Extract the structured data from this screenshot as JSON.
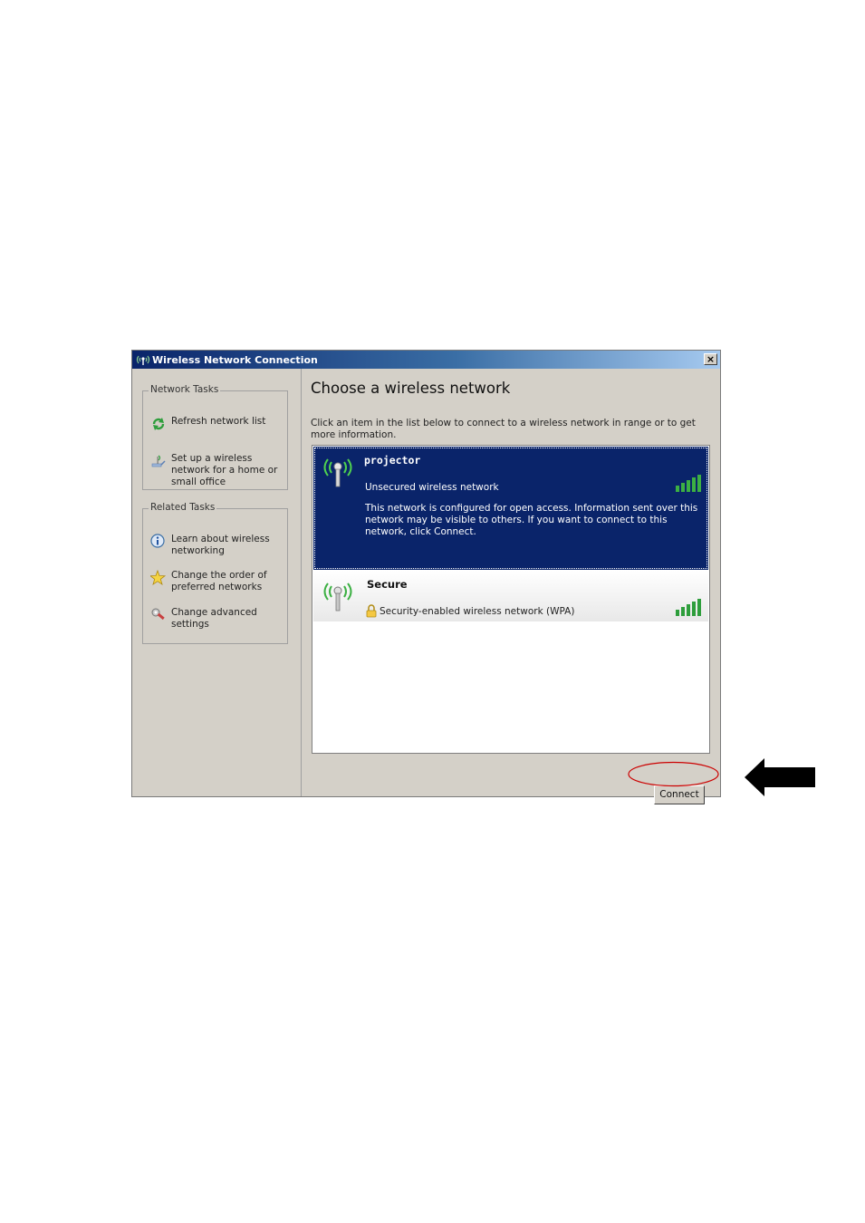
{
  "window": {
    "title": "Wireless Network Connection",
    "close_label": "×"
  },
  "sidebar": {
    "network_tasks": {
      "title": "Network Tasks",
      "items": [
        {
          "label": "Refresh network list",
          "icon": "refresh-icon"
        },
        {
          "label": "Set up a wireless network for a home or small office",
          "icon": "setup-network-icon"
        }
      ]
    },
    "related_tasks": {
      "title": "Related Tasks",
      "items": [
        {
          "label": "Learn about wireless networking",
          "icon": "info-icon"
        },
        {
          "label": "Change the order of preferred networks",
          "icon": "star-icon"
        },
        {
          "label": "Change advanced settings",
          "icon": "settings-icon"
        }
      ]
    }
  },
  "main": {
    "heading": "Choose a wireless network",
    "instructions": "Click an item in the list below to connect to a wireless network in range or to get more information.",
    "networks": [
      {
        "name": "projector",
        "status": "Unsecured wireless network",
        "description": "This network is configured for open access. Information sent over this network may be visible to others. If you want to connect to this network, click Connect.",
        "selected": true
      },
      {
        "name": "Secure",
        "status": "Security-enabled wireless network (WPA)",
        "selected": false
      }
    ],
    "connect_label": "Connect"
  },
  "colors": {
    "selection": "#0a246a",
    "signal": "#2e9e3c",
    "annotation_oval": "#cc0000",
    "arrow": "#000000"
  }
}
